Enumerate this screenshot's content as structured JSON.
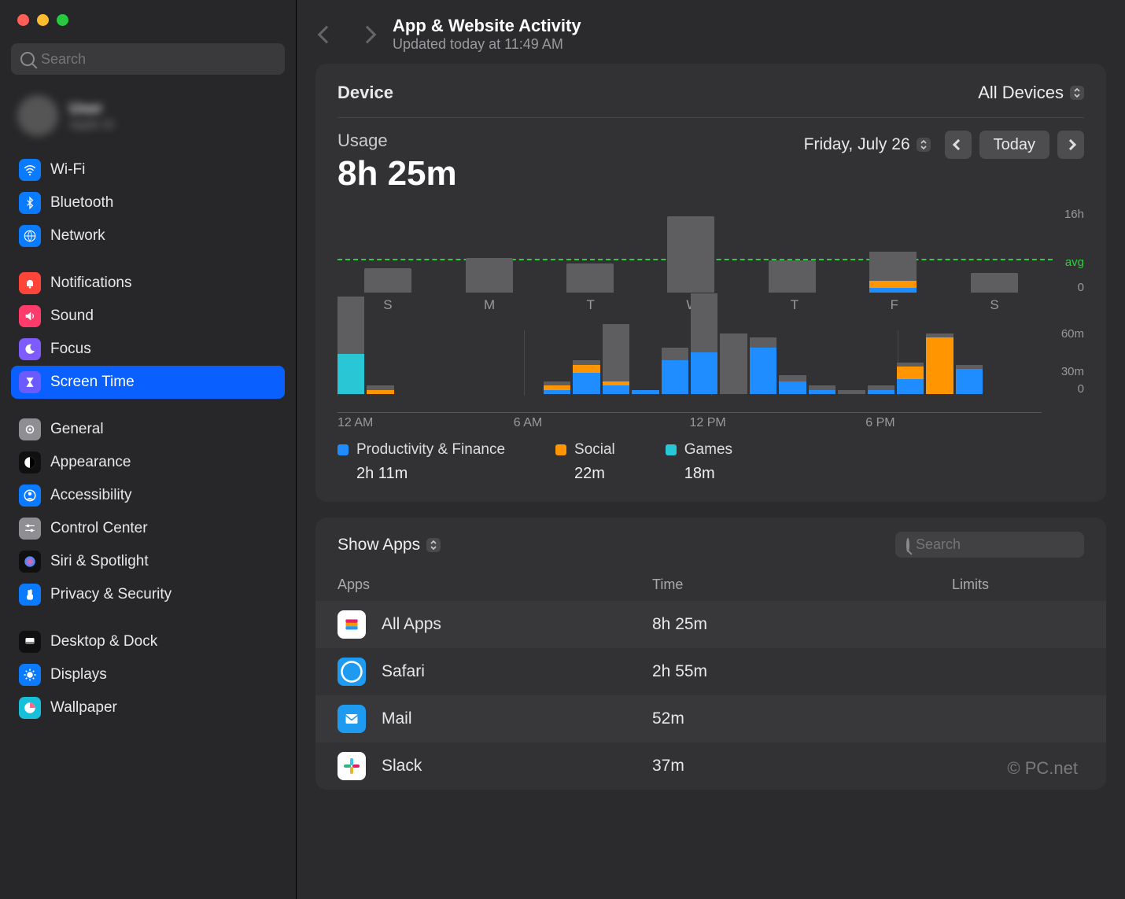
{
  "sidebar": {
    "search_placeholder": "Search",
    "profile_name": "User",
    "profile_sub": "Apple ID",
    "groups": [
      [
        {
          "name": "Wi-Fi",
          "icon": "wifi",
          "bg": "#0a7bff"
        },
        {
          "name": "Bluetooth",
          "icon": "bt",
          "bg": "#0a7bff"
        },
        {
          "name": "Network",
          "icon": "globe",
          "bg": "#0a7bff"
        }
      ],
      [
        {
          "name": "Notifications",
          "icon": "bell",
          "bg": "#ff453a"
        },
        {
          "name": "Sound",
          "icon": "sound",
          "bg": "#ff3b6b"
        },
        {
          "name": "Focus",
          "icon": "moon",
          "bg": "#7d5bff"
        },
        {
          "name": "Screen Time",
          "icon": "hourglass",
          "bg": "#6b5bff",
          "active": true
        }
      ],
      [
        {
          "name": "General",
          "icon": "gear",
          "bg": "#8e8e93"
        },
        {
          "name": "Appearance",
          "icon": "contrast",
          "bg": "#101010"
        },
        {
          "name": "Accessibility",
          "icon": "person",
          "bg": "#0a7bff"
        },
        {
          "name": "Control Center",
          "icon": "sliders",
          "bg": "#8e8e93"
        },
        {
          "name": "Siri & Spotlight",
          "icon": "siri",
          "bg": "#101010"
        },
        {
          "name": "Privacy & Security",
          "icon": "hand",
          "bg": "#0a7bff"
        }
      ],
      [
        {
          "name": "Desktop & Dock",
          "icon": "dock",
          "bg": "#101010"
        },
        {
          "name": "Displays",
          "icon": "sun",
          "bg": "#0a7bff"
        },
        {
          "name": "Wallpaper",
          "icon": "wall",
          "bg": "#18bfd8"
        }
      ]
    ]
  },
  "header": {
    "title": "App & Website Activity",
    "subtitle": "Updated today at 11:49 AM"
  },
  "device": {
    "label": "Device",
    "value": "All Devices"
  },
  "usage": {
    "label": "Usage",
    "total": "8h 25m",
    "date": "Friday, July 26",
    "today_label": "Today"
  },
  "chart_data": {
    "week": {
      "type": "bar",
      "categories": [
        "S",
        "M",
        "T",
        "W",
        "T",
        "F",
        "S"
      ],
      "values_hours": [
        5,
        7,
        6,
        15.5,
        6.5,
        8.4,
        4
      ],
      "friday_stack": {
        "blue": 1,
        "orange": 1.4,
        "grey": 6
      },
      "ylim": [
        0,
        16
      ],
      "ylabel_top": "16h",
      "ylabel_bot": "0",
      "avg_label": "avg",
      "avg_at": 8.5
    },
    "hourly": {
      "type": "stacked-bar",
      "x_ticks": [
        "12 AM",
        "6 AM",
        "12 PM",
        "6 PM"
      ],
      "ylim": [
        0,
        60
      ],
      "ytick_top": "60m",
      "ytick_mid": "30m",
      "ytick_bot": "0",
      "bars": [
        {
          "h": 0,
          "grey": 55,
          "cyan": 38
        },
        {
          "h": 1,
          "grey": 4,
          "orange": 4
        },
        {
          "h": 2
        },
        {
          "h": 3
        },
        {
          "h": 4
        },
        {
          "h": 5
        },
        {
          "h": 6
        },
        {
          "h": 7,
          "blue": 4,
          "orange": 4,
          "grey": 4
        },
        {
          "h": 8,
          "blue": 20,
          "orange": 8,
          "grey": 4
        },
        {
          "h": 9,
          "blue": 8,
          "orange": 4,
          "grey": 55
        },
        {
          "h": 10,
          "blue": 4
        },
        {
          "h": 11,
          "blue": 32,
          "grey": 12
        },
        {
          "h": 12,
          "blue": 40,
          "grey": 56
        },
        {
          "h": 13,
          "grey": 58
        },
        {
          "h": 14,
          "blue": 44,
          "grey": 10
        },
        {
          "h": 15,
          "blue": 12,
          "grey": 6
        },
        {
          "h": 16,
          "blue": 4,
          "grey": 4
        },
        {
          "h": 17,
          "grey": 4
        },
        {
          "h": 18,
          "blue": 4,
          "grey": 4
        },
        {
          "h": 19,
          "blue": 14,
          "orange": 12,
          "grey": 4
        },
        {
          "h": 20,
          "orange": 54,
          "grey": 4
        },
        {
          "h": 21,
          "blue": 24,
          "grey": 4
        }
      ]
    },
    "legend": [
      {
        "label": "Productivity & Finance",
        "color": "#1f8dff",
        "value": "2h 11m"
      },
      {
        "label": "Social",
        "color": "#ff9500",
        "value": "22m"
      },
      {
        "label": "Games",
        "color": "#29c6d6",
        "value": "18m"
      }
    ]
  },
  "apps_section": {
    "selector": "Show Apps",
    "search_placeholder": "Search",
    "columns": {
      "c1": "Apps",
      "c2": "Time",
      "c3": "Limits"
    },
    "rows": [
      {
        "name": "All Apps",
        "time": "8h 25m",
        "icon": "stack",
        "bg": "#ffffff"
      },
      {
        "name": "Safari",
        "time": "2h 55m",
        "icon": "safari",
        "bg": "#1e9af1"
      },
      {
        "name": "Mail",
        "time": "52m",
        "icon": "mail",
        "bg": "#1e9af1"
      },
      {
        "name": "Slack",
        "time": "37m",
        "icon": "slack",
        "bg": "#ffffff"
      }
    ]
  },
  "watermark": "© PC.net",
  "colors": {
    "blue": "#1f8dff",
    "orange": "#ff9500",
    "cyan": "#29c6d6",
    "grey": "#5e5e61"
  }
}
